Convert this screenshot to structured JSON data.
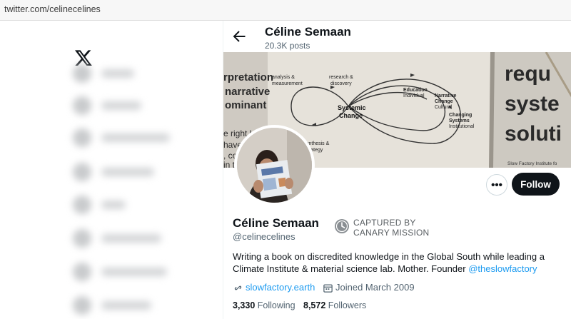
{
  "browser": {
    "url": "twitter.com/celinecelines"
  },
  "nav": {
    "logo_icon": "x-logo-icon",
    "items": [
      "home",
      "explore",
      "notifications",
      "messages",
      "lists",
      "bookmarks",
      "communities",
      "premium"
    ]
  },
  "header": {
    "name": "Céline Semaan",
    "posts": "20.3K posts",
    "back_icon": "arrow-left-icon"
  },
  "banner": {
    "texts": {
      "left1": "rpretation",
      "left2": "narrative",
      "left3": "ominant",
      "left4": "e right k",
      "left5": "have",
      "left6": ", co",
      "left7": "in t",
      "diag_analysis1": "analysis &",
      "diag_analysis2": "measurement",
      "diag_research1": "research &",
      "diag_research2": "discovery",
      "diag_center1": "Systemic",
      "diag_center2": "Change",
      "diag_edu1": "Education",
      "diag_edu2": "Individual",
      "diag_narr1": "Narrative",
      "diag_narr2": "Change",
      "diag_narr3": "Cultural",
      "diag_sys1": "Changing",
      "diag_sys2": "Systems",
      "diag_sys3": "Institutional",
      "diag_synth1": "ynthesis &",
      "diag_synth2": "trategy",
      "right1": "requ",
      "right2": "syste",
      "right3": "soluti",
      "right_small": "Slow Factory Institute fo"
    }
  },
  "profile": {
    "name": "Céline Semaan",
    "handle": "@celinecelines",
    "follow_label": "Follow",
    "more_label": "•••",
    "captured_line1": "CAPTURED BY",
    "captured_line2": "CANARY MISSION",
    "bio_text": "Writing a book on discredited knowledge in the Global South while leading a Climate Institute & material science lab. Mother. Founder ",
    "bio_mention": "@theslowfactory",
    "website": "slowfactory.earth",
    "joined": "Joined March 2009",
    "following_count": "3,330",
    "following_label": "Following",
    "followers_count": "8,572",
    "followers_label": "Followers"
  },
  "colors": {
    "accent": "#1d9bf0",
    "follow_bg": "#0f1419",
    "muted": "#536471"
  }
}
